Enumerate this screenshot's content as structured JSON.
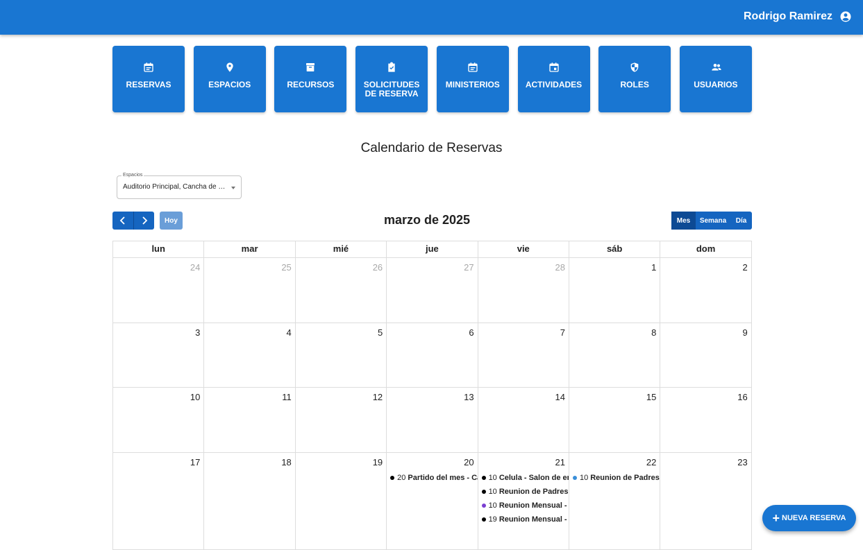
{
  "header": {
    "user_name": "Rodrigo Ramirez",
    "user_icon": "account-circle-icon"
  },
  "nav": [
    {
      "label": "RESERVAS",
      "icon": "calendar-icon"
    },
    {
      "label": "ESPACIOS",
      "icon": "location-pin-icon"
    },
    {
      "label": "RECURSOS",
      "icon": "archive-icon"
    },
    {
      "label": "SOLICITUDES DE RESERVA",
      "icon": "clipboard-check-icon"
    },
    {
      "label": "MINISTERIOS",
      "icon": "calendar-icon"
    },
    {
      "label": "ACTIVIDADES",
      "icon": "calendar-event-icon"
    },
    {
      "label": "ROLES",
      "icon": "shield-icon"
    },
    {
      "label": "USUARIOS",
      "icon": "people-icon"
    }
  ],
  "page": {
    "title": "Calendario de Reservas"
  },
  "filter": {
    "label": "Espacios",
    "value": "Auditorio Principal, Cancha de Fú..."
  },
  "toolbar": {
    "today_label": "Hoy",
    "month_title": "marzo de 2025",
    "views": [
      "Mes",
      "Semana",
      "Día"
    ],
    "active_view": "Mes"
  },
  "calendar": {
    "weekdays": [
      "lun",
      "mar",
      "mié",
      "jue",
      "vie",
      "sáb",
      "dom"
    ],
    "weeks": [
      [
        {
          "day": "24",
          "other": true
        },
        {
          "day": "25",
          "other": true
        },
        {
          "day": "26",
          "other": true
        },
        {
          "day": "27",
          "other": true
        },
        {
          "day": "28",
          "other": true
        },
        {
          "day": "1"
        },
        {
          "day": "2"
        }
      ],
      [
        {
          "day": "3"
        },
        {
          "day": "4"
        },
        {
          "day": "5"
        },
        {
          "day": "6"
        },
        {
          "day": "7"
        },
        {
          "day": "8"
        },
        {
          "day": "9"
        }
      ],
      [
        {
          "day": "10"
        },
        {
          "day": "11"
        },
        {
          "day": "12"
        },
        {
          "day": "13"
        },
        {
          "day": "14"
        },
        {
          "day": "15"
        },
        {
          "day": "16"
        }
      ],
      [
        {
          "day": "17"
        },
        {
          "day": "18"
        },
        {
          "day": "19"
        },
        {
          "day": "20",
          "events": [
            {
              "time": "20",
              "title": "Partido del mes - Cancha",
              "color": "#000000"
            }
          ]
        },
        {
          "day": "21",
          "events": [
            {
              "time": "10",
              "title": "Celula - Salon de entrada",
              "color": "#000000"
            },
            {
              "time": "10",
              "title": "Reunion de Padres - Auditorio",
              "color": "#000000"
            },
            {
              "time": "10",
              "title": "Reunion Mensual - Cancha",
              "color": "#7b3fd1"
            },
            {
              "time": "19",
              "title": "Reunion Mensual - Salon",
              "color": "#000000"
            }
          ]
        },
        {
          "day": "22",
          "events": [
            {
              "time": "10",
              "title": "Reunion de Padres - Auditorio",
              "color": "#3a8fd9"
            }
          ]
        },
        {
          "day": "23"
        }
      ]
    ]
  },
  "fab": {
    "label": "NUEVA RESERVA",
    "icon": "plus-icon"
  }
}
